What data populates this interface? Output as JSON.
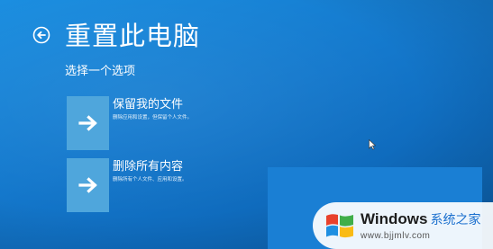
{
  "header": {
    "back_icon": "back-arrow-circle-icon",
    "title": "重置此电脑"
  },
  "prompt": "选择一个选项",
  "options": [
    {
      "icon": "right-arrow-icon",
      "title": "保留我的文件",
      "description": "删除应用和设置，但保留个人文件。"
    },
    {
      "icon": "right-arrow-icon",
      "title": "删除所有内容",
      "description": "删除所有个人文件、应用和设置。"
    }
  ],
  "watermark": {
    "logo": "windows-logo-icon",
    "brand": "Windows",
    "brand_cn": "系统之家",
    "url": "www.bjjmlv.com"
  },
  "colors": {
    "background": "#1478cc",
    "tile": "#4fa6dc",
    "text": "#ffffff"
  }
}
